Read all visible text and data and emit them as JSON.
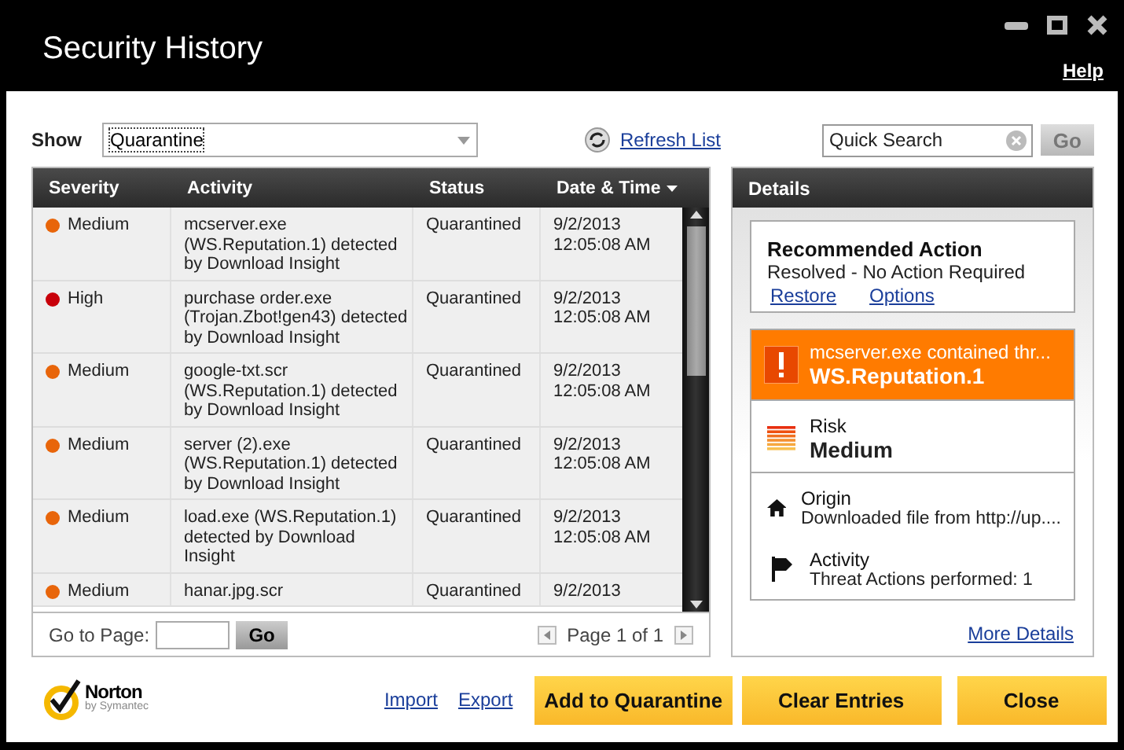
{
  "window": {
    "title": "Security History",
    "help": "Help"
  },
  "filter": {
    "label": "Show",
    "value": "Quarantine",
    "refresh": "Refresh List",
    "search_placeholder": "Quick Search",
    "go": "Go"
  },
  "table": {
    "columns": [
      {
        "label": "Severity",
        "sorted": false
      },
      {
        "label": "Activity",
        "sorted": false
      },
      {
        "label": "Status",
        "sorted": false
      },
      {
        "label": "Date & Time",
        "sorted": true
      }
    ],
    "rows": [
      {
        "severity": "Medium",
        "color": "#e8650a",
        "activity": "mcserver.exe (WS.Reputation.1) detected by Download Insight",
        "status": "Quarantined",
        "date": "9/2/2013",
        "time": "12:05:08 AM"
      },
      {
        "severity": "High",
        "color": "#c8000a",
        "activity": "purchase order.exe (Trojan.Zbot!gen43) detected by Download Insight",
        "status": "Quarantined",
        "date": "9/2/2013",
        "time": "12:05:08 AM"
      },
      {
        "severity": "Medium",
        "color": "#e8650a",
        "activity": "google-txt.scr (WS.Reputation.1) detected by Download Insight",
        "status": "Quarantined",
        "date": "9/2/2013",
        "time": "12:05:08 AM"
      },
      {
        "severity": "Medium",
        "color": "#e8650a",
        "activity": "server (2).exe (WS.Reputation.1) detected by Download Insight",
        "status": "Quarantined",
        "date": "9/2/2013",
        "time": "12:05:08 AM"
      },
      {
        "severity": "Medium",
        "color": "#e8650a",
        "activity": "load.exe (WS.Reputation.1) detected by Download Insight",
        "status": "Quarantined",
        "date": "9/2/2013",
        "time": "12:05:08 AM"
      },
      {
        "severity": "Medium",
        "color": "#e8650a",
        "activity": "hanar.jpg.scr",
        "status": "Quarantined",
        "date": "9/2/2013",
        "time": ""
      }
    ]
  },
  "pager": {
    "label": "Go to Page:",
    "go": "Go",
    "page": "Page 1 of 1"
  },
  "details": {
    "title": "Details",
    "recommended": {
      "title": "Recommended Action",
      "status": "Resolved - No Action Required",
      "links": [
        "Restore",
        "Options"
      ]
    },
    "threat": {
      "title": "mcserver.exe contained thr...",
      "name": "WS.Reputation.1"
    },
    "facts": [
      {
        "kind": "risk",
        "label": "Risk",
        "value": "Medium"
      },
      {
        "kind": "origin",
        "label": "Origin",
        "value": "Downloaded file from http://up...."
      },
      {
        "kind": "activity",
        "label": "Activity",
        "value": "Threat Actions performed: 1"
      }
    ],
    "more": "More Details"
  },
  "footer": {
    "brand": "Norton",
    "brand_sub": "by Symantec",
    "links": [
      "Import",
      "Export"
    ],
    "buttons": [
      "Add to Quarantine",
      "Clear Entries",
      "Close"
    ]
  }
}
